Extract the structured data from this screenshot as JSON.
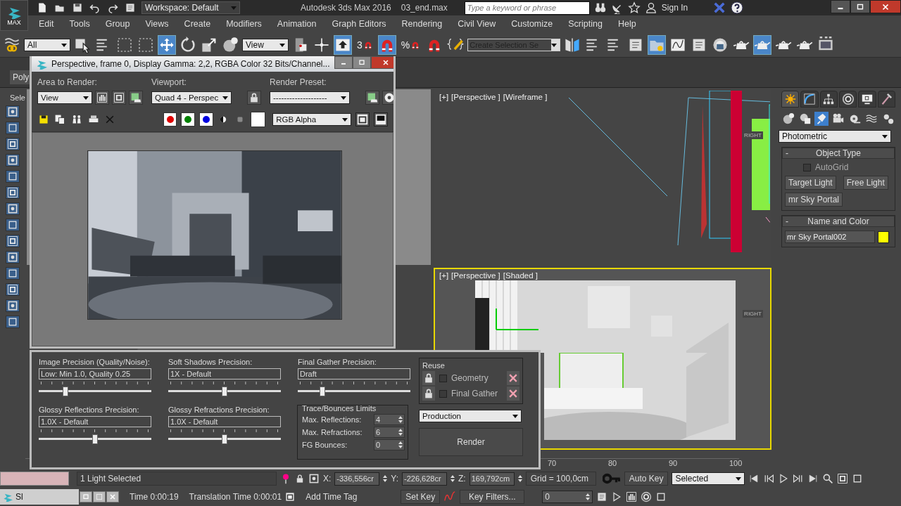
{
  "title_bar": {
    "app_button": "MAX",
    "workspace": "Workspace: Default",
    "title": "Autodesk 3ds Max 2016",
    "file": "03_end.max",
    "search": {
      "placeholder": "Type a keyword or phrase"
    },
    "sign_in": "Sign In"
  },
  "menu_bar": [
    "Edit",
    "Tools",
    "Group",
    "Views",
    "Create",
    "Modifiers",
    "Animation",
    "Graph Editors",
    "Rendering",
    "Civil View",
    "Customize",
    "Scripting",
    "Help"
  ],
  "main_toolbar": [
    {
      "kind": "tool",
      "selected": false
    },
    {
      "kind": "dropdown",
      "value": "All"
    },
    {
      "kind": "tool",
      "selected": false
    },
    {
      "kind": "tool",
      "selected": false
    },
    {
      "kind": "tool",
      "selected": false
    },
    {
      "kind": "tool",
      "selected": false
    },
    {
      "kind": "tool",
      "selected": true
    },
    {
      "kind": "tool",
      "selected": false
    },
    {
      "kind": "tool",
      "selected": false
    },
    {
      "kind": "tool",
      "selected": false
    },
    {
      "kind": "dropdown",
      "value": "View"
    },
    {
      "kind": "tool",
      "selected": false
    },
    {
      "kind": "tool",
      "selected": false
    },
    {
      "kind": "tool",
      "selected": true
    },
    {
      "kind": "snap",
      "label": "3",
      "selected": false
    },
    {
      "kind": "tool",
      "selected": true
    },
    {
      "kind": "snap",
      "label": "%",
      "selected": false
    },
    {
      "kind": "tool",
      "selected": false
    },
    {
      "kind": "tool",
      "selected": false
    },
    {
      "kind": "selection_set",
      "placeholder": "Create Selection Se"
    },
    {
      "kind": "tool",
      "selected": false
    },
    {
      "kind": "tool",
      "selected": false
    },
    {
      "kind": "tool",
      "selected": false
    },
    {
      "kind": "tool",
      "selected": false
    },
    {
      "kind": "tool",
      "selected": true
    },
    {
      "kind": "tool",
      "selected": false
    },
    {
      "kind": "tool",
      "selected": false
    },
    {
      "kind": "tool",
      "selected": false
    },
    {
      "kind": "tool",
      "selected": false
    },
    {
      "kind": "tool",
      "selected": true
    },
    {
      "kind": "tool",
      "selected": false
    },
    {
      "kind": "tool",
      "selected": false
    },
    {
      "kind": "tool",
      "selected": false
    }
  ],
  "ribbon": {
    "tab": "Poly",
    "panel_label": "Sele"
  },
  "viewports": [
    {
      "plus": "[+]",
      "name": "[Perspective ]",
      "mode": "[Wireframe ]",
      "view_cube": "RIGHT",
      "active": false
    },
    {
      "plus": "[+]",
      "name": "[Perspective ]",
      "mode": "[Shaded ]",
      "view_cube": "RIGHT",
      "active": true
    }
  ],
  "command_panel": {
    "tabs": [
      {
        "selected": true
      },
      {
        "selected": false
      },
      {
        "selected": false
      },
      {
        "selected": false
      },
      {
        "selected": false
      },
      {
        "selected": false
      }
    ],
    "categories": [
      {
        "selected": false
      },
      {
        "selected": false
      },
      {
        "selected": true
      },
      {
        "selected": false
      },
      {
        "selected": false
      },
      {
        "selected": false
      },
      {
        "selected": false
      }
    ],
    "type": "Photometric",
    "object_type": {
      "toggle": "-",
      "title": "Object Type",
      "autogrid": {
        "label": "AutoGrid",
        "checked": false
      },
      "buttons": [
        "Target Light",
        "Free Light",
        "mr Sky Portal"
      ]
    },
    "name_and_color": {
      "toggle": "-",
      "title": "Name and Color",
      "name": "mr Sky Portal002",
      "color": "#ffff00"
    }
  },
  "timeline": {
    "ticks": [
      "70",
      "80",
      "90",
      "100"
    ]
  },
  "render_window": {
    "title": "Perspective, frame 0, Display Gamma: 2,2, RGBA Color 32 Bits/Channel...",
    "area_label": "Area to Render:",
    "area": "View",
    "viewport_label": "Viewport:",
    "viewport": "Quad 4 - Perspec",
    "preset_label": "Render Preset:",
    "preset": "--------------------",
    "channels": [
      {
        "color": "#e00000",
        "selected": true
      },
      {
        "color": "#008000",
        "selected": true
      },
      {
        "color": "#0000e0",
        "selected": true
      }
    ],
    "display": "RGB Alpha"
  },
  "render_settings": {
    "sliders": [
      {
        "label": "Image Precision (Quality/Noise):",
        "value": "Low: Min 1.0, Quality 0.25",
        "level": 0.24
      },
      {
        "label": "Soft Shadows Precision:",
        "value": "1X - Default",
        "level": 0.5
      },
      {
        "label": "Final Gather Precision:",
        "value": "Draft",
        "level": 0.22
      },
      {
        "label": "Glossy Reflections Precision:",
        "value": "1.0X - Default",
        "level": 0.5
      },
      {
        "label": "Glossy Refractions Precision:",
        "value": "1.0X - Default",
        "level": 0.5
      }
    ],
    "reuse": {
      "title": "Reuse",
      "items": [
        {
          "label": "Geometry",
          "checked": false
        },
        {
          "label": "Final Gather",
          "checked": false
        }
      ]
    },
    "limits": {
      "title": "Trace/Bounces Limits",
      "fields": [
        {
          "label": "Max. Reflections:",
          "value": "4"
        },
        {
          "label": "Max. Refractions:",
          "value": "6"
        },
        {
          "label": "FG Bounces:",
          "value": "0"
        }
      ]
    },
    "mode": "Production",
    "render_button": "Render"
  },
  "status_bar": {
    "selection": "1 Light Selected",
    "x_label": "X:",
    "x": "-336,556cr",
    "y_label": "Y:",
    "y": "-226,628cr",
    "z_label": "Z:",
    "z": "169,792cm",
    "grid": "Grid = 100,0cm",
    "auto_key": "Auto Key",
    "key_mode": "Selected",
    "set_key": "Set Key",
    "key_filters": "Key Filters...",
    "frame": "0",
    "time": "Time  0:00:19",
    "translation_time": "Translation Time  0:00:01",
    "add_time_tag": "Add Time Tag",
    "taskbar_item": "Sl"
  }
}
